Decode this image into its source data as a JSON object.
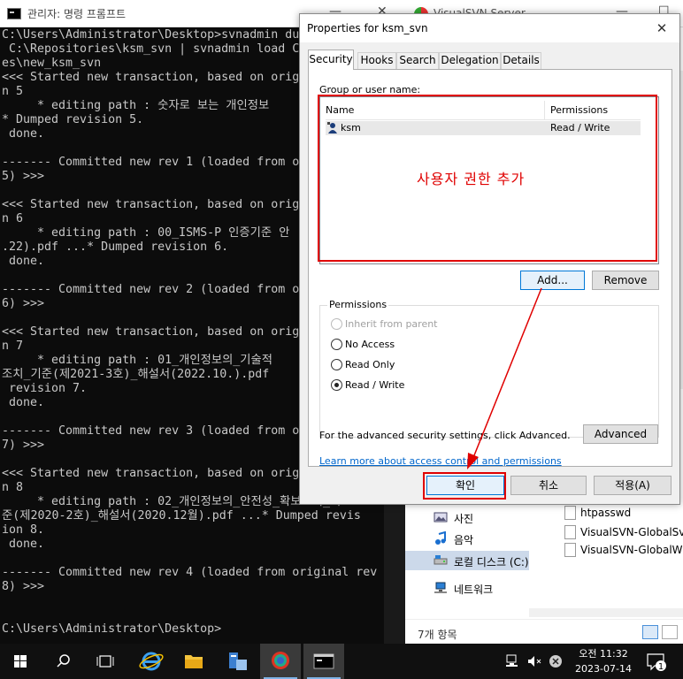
{
  "cmd": {
    "title": "관리자: 명령 프롬프트",
    "lines": [
      "C:\\Users\\Administrator\\Desktop>svnadmin du",
      " C:\\Repositories\\ksm_svn | svnadmin load C",
      "es\\new_ksm_svn",
      "<<< Started new transaction, based on orig",
      "n 5",
      "     * editing path : 숫자로 보는 개인정보",
      "* Dumped revision 5.",
      " done.",
      "",
      "------- Committed new rev 1 (loaded from o",
      "5) >>>",
      "",
      "<<< Started new transaction, based on orig",
      "n 6",
      "     * editing path : 00_ISMS-P 인증기준 안",
      ".22).pdf ...* Dumped revision 6.",
      " done.",
      "",
      "------- Committed new rev 2 (loaded from o",
      "6) >>>",
      "",
      "<<< Started new transaction, based on orig",
      "n 7",
      "     * editing path : 01_개인정보의_기술적",
      "조치_기준(제2021-3호)_해설서(2022.10.).pdf",
      " revision 7.",
      " done.",
      "",
      "------- Committed new rev 3 (loaded from o",
      "7) >>>",
      "",
      "<<< Started new transaction, based on orig",
      "n 8",
      "     * editing path : 02_개인정보의_안전성_확보조치_기",
      "준(제2020-2호)_해설서(2020.12월).pdf ...* Dumped revis",
      "ion 8.",
      " done.",
      "",
      "------- Committed new rev 4 (loaded from original rev",
      "8) >>>",
      "",
      "",
      "C:\\Users\\Administrator\\Desktop>"
    ]
  },
  "svn": {
    "title": "VisualSVN Server",
    "nav": [
      {
        "label": "사진",
        "icon": "pictures-icon"
      },
      {
        "label": "음악",
        "icon": "music-icon"
      },
      {
        "label": "로컬 디스크 (C:)",
        "icon": "drive-icon"
      },
      {
        "label": "네트워크",
        "icon": "network-icon"
      }
    ],
    "files": [
      "htpasswd",
      "VisualSVN-GlobalSvn",
      "VisualSVN-GlobalWin"
    ],
    "item_count": "7개 항목"
  },
  "dialog": {
    "title": "Properties for ksm_svn",
    "tabs": [
      "Security",
      "Hooks",
      "Search",
      "Delegation",
      "Details"
    ],
    "group_label": "Group or user name:",
    "col_name": "Name",
    "col_permissions": "Permissions",
    "user": {
      "name": "ksm",
      "permission": "Read / Write"
    },
    "add_label": "Add...",
    "remove_label": "Remove",
    "permissions_legend": "Permissions",
    "options": {
      "inherit": "Inherit from parent",
      "no_access": "No Access",
      "read_only": "Read Only",
      "read_write": "Read / Write"
    },
    "advanced_text": "For the advanced security settings, click Advanced.",
    "advanced_label": "Advanced",
    "learn_link": "Learn more about access control and permissions",
    "ok_label": "확인",
    "cancel_label": "취소",
    "apply_label": "적용(A)"
  },
  "annotation": {
    "text": "사용자 권한 추가",
    "color": "#e00000"
  },
  "taskbar": {
    "time": "오전 11:32",
    "date": "2023-07-14",
    "notification_count": "1"
  }
}
